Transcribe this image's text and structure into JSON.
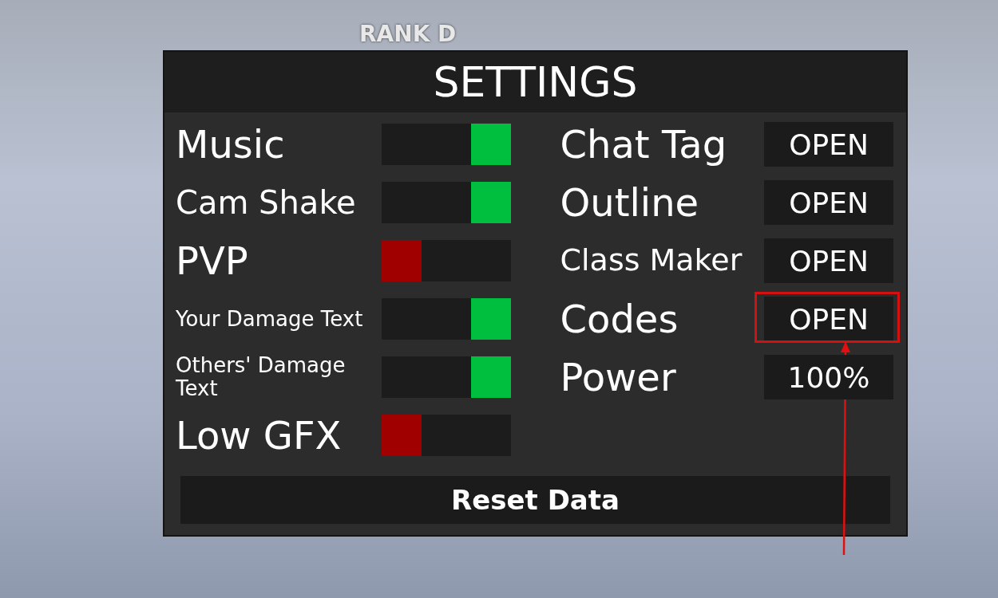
{
  "scene": {
    "rank_label": "RANK D"
  },
  "settings": {
    "title": "SETTINGS",
    "toggles": [
      {
        "label": "Music",
        "on": true
      },
      {
        "label": "Cam Shake",
        "on": true
      },
      {
        "label": "PVP",
        "on": false
      },
      {
        "label": "Your Damage Text",
        "on": true
      },
      {
        "label": "Others' Damage Text",
        "on": true
      },
      {
        "label": "Low GFX",
        "on": false
      }
    ],
    "options": [
      {
        "label": "Chat Tag",
        "value": "OPEN",
        "highlighted": false
      },
      {
        "label": "Outline",
        "value": "OPEN",
        "highlighted": false
      },
      {
        "label": "Class Maker",
        "value": "OPEN",
        "highlighted": false
      },
      {
        "label": "Codes",
        "value": "OPEN",
        "highlighted": true
      },
      {
        "label": "Power",
        "value": "100%",
        "highlighted": false
      }
    ],
    "reset_button": "Reset Data"
  }
}
